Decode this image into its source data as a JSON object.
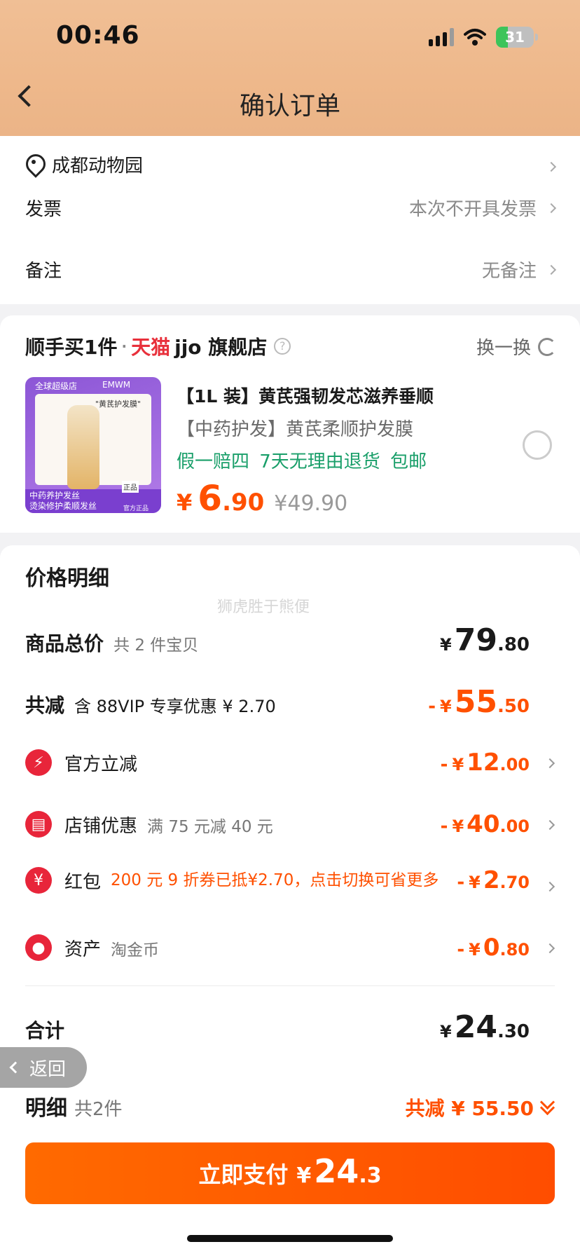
{
  "status": {
    "time": "00:46",
    "battery": "31"
  },
  "nav": {
    "title": "确认订单"
  },
  "address": {
    "name": "成都动物园"
  },
  "invoice": {
    "label": "发票",
    "value": "本次不开具发票"
  },
  "remark": {
    "label": "备注",
    "value": "无备注"
  },
  "shunshou": {
    "title": "顺手买1件",
    "tmall": "天猫",
    "store": "jjo 旗舰店",
    "swap": "换一换",
    "product": {
      "name": "【1L 装】黄芪强韧发芯滋养垂顺",
      "subtitle": "【中药护发】黄芪柔顺护发膜",
      "tags": "假一赔四  7天无理由退货  包邮",
      "price_symbol": "¥",
      "price_int": "6",
      "price_dec": ".90",
      "original_price": "¥49.90",
      "image_texts": {
        "top_tag": "全球超级店",
        "brand": "EMWM",
        "bubble": "\"黄芪护发膜\"",
        "band1": "中药养护发丝",
        "band2": "烫染修护柔顺发丝",
        "badge1": "正品",
        "badge2": "官方正品"
      }
    }
  },
  "price_detail": {
    "title": "价格明细",
    "watermark": "狮虎胜于熊便",
    "total_goods": {
      "label": "商品总价",
      "sub": "共 2 件宝贝",
      "cur": "¥",
      "int": "79",
      "dec": ".80"
    },
    "total_discount": {
      "label": "共减",
      "sub": "含 88VIP 专享优惠 ¥ 2.70",
      "minus": "-",
      "cur": "¥",
      "int": "55",
      "dec": ".50"
    },
    "items": [
      {
        "label": "官方立减",
        "sub": "",
        "int": "12",
        "dec": ".00"
      },
      {
        "label": "店铺优惠",
        "sub": "满 75 元减 40 元",
        "int": "40",
        "dec": ".00"
      },
      {
        "label": "红包",
        "sub": "200 元 9 折券已抵¥2.70，点击切换可省更多",
        "int": "2",
        "dec": ".70"
      },
      {
        "label": "资产",
        "sub": "淘金币",
        "int": "0",
        "dec": ".80"
      }
    ],
    "minus": "-",
    "cur": "¥",
    "total": {
      "label": "合计",
      "cur": "¥",
      "int": "24",
      "dec": ".30"
    }
  },
  "return_btn": "返回",
  "detail": {
    "label": "明细",
    "sub": "共2件",
    "save": "共减 ¥ 55.50"
  },
  "pay": {
    "label": "立即支付",
    "cur": "¥",
    "int": "24",
    "dec": ".3"
  }
}
